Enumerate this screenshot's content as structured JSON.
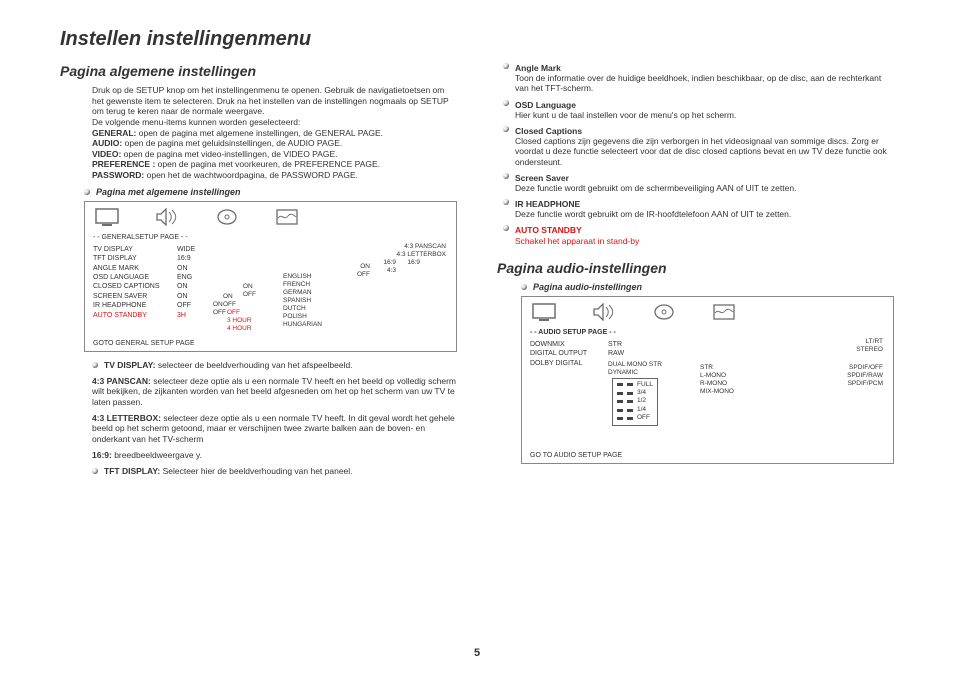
{
  "title": "Instellen instellingenmenu",
  "left": {
    "heading": "Pagina algemene instellingen",
    "intro1": "Druk op de SETUP knop om het instellingenmenu te openen. Gebruik de navigatietoetsen om het gewenste item te selecteren. Druk na het instellen van de instellingen nogmaals op SETUP om terug te keren naar de normale weergave.",
    "intro2": "De volgende menu-items kunnen worden geselecteerd:",
    "items": [
      {
        "b": "GENERAL:",
        "t": " open de pagina met algemene instellingen, de GENERAL PAGE."
      },
      {
        "b": "AUDIO:",
        "t": " open de pagina met geluidsinstellingen, de AUDIO PAGE."
      },
      {
        "b": "VIDEO:",
        "t": " open de pagina met video-instellingen, de VIDEO PAGE."
      },
      {
        "b": "PREFERENCE :",
        "t": " open de pagina met voorkeuren, de PREFERENCE PAGE."
      },
      {
        "b": "PASSWORD:",
        "t": " open het de wachtwoordpagina, de PASSWORD PAGE."
      }
    ],
    "panel_sub": "Pagina met algemene instellingen",
    "panel": {
      "pagelabel": "- -  GENERALSETUP PAGE  - -",
      "rows": [
        {
          "k": "TV DISPLAY",
          "v": "WIDE"
        },
        {
          "k": "TFT DISPLAY",
          "v": "16:9"
        },
        {
          "k": "ANGLE MARK",
          "v": "ON"
        },
        {
          "k": "OSD LANGUAGE",
          "v": "ENG"
        },
        {
          "k": "CLOSED CAPTIONS",
          "v": "ON"
        },
        {
          "k": "SCREEN SAVER",
          "v": "ON"
        },
        {
          "k": "IR HEADPHONE",
          "v": "OFF"
        },
        {
          "k": "AUTO STANDBY",
          "v": "3H",
          "red": true
        }
      ],
      "footer": "GOTO GENERAL SETUP PAGE",
      "tv_opts": [
        "4:3 PANSCAN",
        "4:3 LETTERBOX",
        "16:9"
      ],
      "tft_opts": [
        "16:9",
        "4:3"
      ],
      "onoff": [
        "ON",
        "OFF"
      ],
      "lang": [
        "ENGLISH",
        "FRENCH",
        "GERMAN",
        "SPANISH",
        "DUTCH",
        "POLISH",
        "HUNGARIAN"
      ],
      "standby": [
        "OFF",
        "3 HOUR",
        "4 HOUR"
      ]
    },
    "desc": [
      {
        "lead": "TV DISPLAY:",
        "t": " selecteer de beeldverhouding van het afspeelbeeld."
      },
      {
        "lead": "4:3 PANSCAN:",
        "t": " selecteer deze optie als u een normale TV heeft en het beeld op volledig scherm wilt bekijken, de zijkanten worden van het beeld afgesneden om het op het scherm van uw TV te laten passen."
      },
      {
        "lead": "4:3 LETTERBOX:",
        "t": " selecteer deze optie als u een normale TV heeft. In dit geval wordt het gehele beeld op het scherm getoond, maar er verschijnen twee zwarte balken aan de boven- en onderkant van het TV-scherm"
      },
      {
        "lead": "16:9:",
        "t": " breedbeeldweergave y."
      },
      {
        "lead": "TFT DISPLAY:",
        "t": " Selecteer hier de beeldverhouding van het paneel."
      }
    ]
  },
  "right": {
    "items": [
      {
        "hd": "Angle Mark",
        "t": "Toon de informatie over de huidige beeldhoek, indien beschikbaar, op de disc, aan de rechterkant van het TFT-scherm."
      },
      {
        "hd": "OSD Language",
        "t": "Hier kunt u de taal instellen voor de menu's op het scherm."
      },
      {
        "hd": "Closed Captions",
        "t": "Closed captions zijn gegevens die zijn verborgen in het videosignaal van sommige discs. Zorg er voordat u deze functie selecteert voor dat de disc closed captions bevat en uw TV deze functie ook ondersteunt."
      },
      {
        "hd": "Screen Saver",
        "t": "Deze functie wordt gebruikt om de schermbeveiliging AAN of UIT te zetten."
      },
      {
        "hd": "IR HEADPHONE",
        "t": "Deze functie wordt gebruikt om de IR-hoofdtelefoon AAN of UIT te zetten."
      },
      {
        "hd": "AUTO STANDBY",
        "t": "Schakel het apparaat in stand-by",
        "red": true
      }
    ],
    "heading2": "Pagina audio-instellingen",
    "sub2": "Pagina audio-instellingen",
    "panel": {
      "pagelabel": "- -  AUDIO SETUP PAGE  - -",
      "rows": [
        {
          "k": "DOWNMIX",
          "v": "STR"
        },
        {
          "k": "DIGITAL OUTPUT",
          "v": "RAW"
        },
        {
          "k": "DOLBY DIGITAL",
          "v": ""
        }
      ],
      "dm_opts": [
        "LT/RT",
        "STEREO"
      ],
      "do_opts": [
        "SPDIF/OFF",
        "SPDIF/RAW",
        "SPDIF/PCM"
      ],
      "dd_sub": [
        "DUAL MONO  STR",
        "DYNAMIC"
      ],
      "dd_mono": [
        "STR",
        "L-MONO",
        "R-MONO",
        "MIX-MONO"
      ],
      "levels": [
        "FULL",
        "3/4",
        "1/2",
        "1/4",
        "OFF"
      ],
      "footer": "GO TO AUDIO SETUP PAGE"
    }
  },
  "pagenum": "5"
}
